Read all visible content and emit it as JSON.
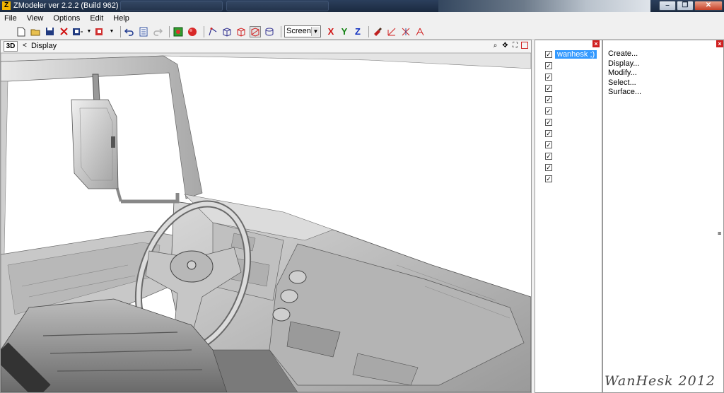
{
  "window": {
    "title": "ZModeler ver 2.2.2 (Build 962)",
    "app_icon": "Z",
    "background_tabs": [
      "",
      ""
    ],
    "min_label": "–",
    "max_label": "❐",
    "close_label": "✕"
  },
  "menu": [
    "File",
    "View",
    "Options",
    "Edit",
    "Help"
  ],
  "toolbar": {
    "mode_select": "Screen",
    "axis_x": "X",
    "axis_y": "Y",
    "axis_z": "Z",
    "icons": [
      "new-icon",
      "open-icon",
      "save-icon",
      "delete-icon",
      "import-icon",
      "export-icon",
      "undo-icon",
      "properties-icon",
      "redo-icon",
      "render-icon",
      "sphere-icon",
      "vertex-icon",
      "cube-icon",
      "box-icon",
      "wireframe-icon",
      "cylinder-icon",
      "paint-icon",
      "axis-x-icon",
      "axis-y-icon",
      "axis-z-icon"
    ]
  },
  "viewport": {
    "badge": "3D",
    "arrow": "<",
    "label": "Display"
  },
  "objects": {
    "items": [
      {
        "name": "wanhesk ;)",
        "checked": true,
        "selected": true
      },
      {
        "name": "",
        "checked": true
      },
      {
        "name": "",
        "checked": true
      },
      {
        "name": "",
        "checked": true
      },
      {
        "name": "",
        "checked": true
      },
      {
        "name": "",
        "checked": true
      },
      {
        "name": "",
        "checked": true
      },
      {
        "name": "",
        "checked": true
      },
      {
        "name": "",
        "checked": true
      },
      {
        "name": "",
        "checked": true
      },
      {
        "name": "",
        "checked": true
      },
      {
        "name": "",
        "checked": true
      }
    ]
  },
  "commands": [
    "Create...",
    "Display...",
    "Modify...",
    "Select...",
    "Surface..."
  ],
  "signature": "WanHesk 2012",
  "colors": {
    "accent_red": "#d02020",
    "selection": "#3399ff",
    "axis_x": "#d01010",
    "axis_y": "#108010",
    "axis_z": "#1030c0"
  }
}
